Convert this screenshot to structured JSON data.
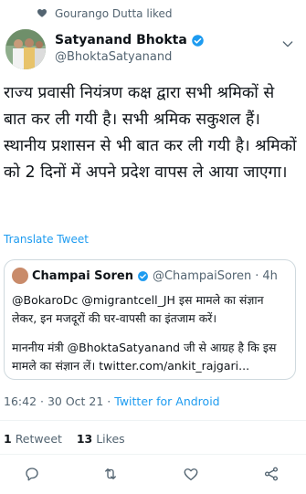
{
  "social_context": {
    "icon": "heart-icon",
    "text": "Gourango Dutta liked"
  },
  "author": {
    "name": "Satyanand Bhokta",
    "handle": "@BhoktaSatyanand",
    "verified": true
  },
  "tweet": {
    "text": "राज्य प्रवासी नियंत्रण कक्ष द्वारा सभी श्रमिकों से बात कर ली गयी है। सभी श्रमिक सकुशल हैं। स्थानीय प्रशासन से भी बात कर ली गयी है। श्रमिकों को 2 दिनों में अपने प्रदेश वापस ले आया जाएगा।",
    "translate_label": "Translate Tweet"
  },
  "quoted": {
    "name": "Champai Soren",
    "handle": "@ChampaiSoren",
    "separator": "·",
    "time": "4h",
    "line1": "@BokaroDc @migrantcell_JH इस मामले का संज्ञान लेकर, इन मजदूरों की घर-वापसी का इंतजाम करें।",
    "line2": "माननीय मंत्री @BhoktaSatyanand जी से आग्रह है कि इस मामले का संज्ञान लें। twitter.com/ankit_rajgari..."
  },
  "meta": {
    "time": "16:42",
    "separator1": " · ",
    "date": "30 Oct 21",
    "separator2": " · ",
    "source": "Twitter for Android"
  },
  "stats": {
    "retweets_count": "1",
    "retweets_label": "Retweet",
    "likes_count": "13",
    "likes_label": "Likes"
  },
  "actions": [
    "reply-icon",
    "retweet-icon",
    "like-icon",
    "share-icon"
  ],
  "colors": {
    "accent": "#1d9bf0",
    "secondary_text": "#536471",
    "primary_text": "#0f1419",
    "border": "#cfd9de"
  }
}
